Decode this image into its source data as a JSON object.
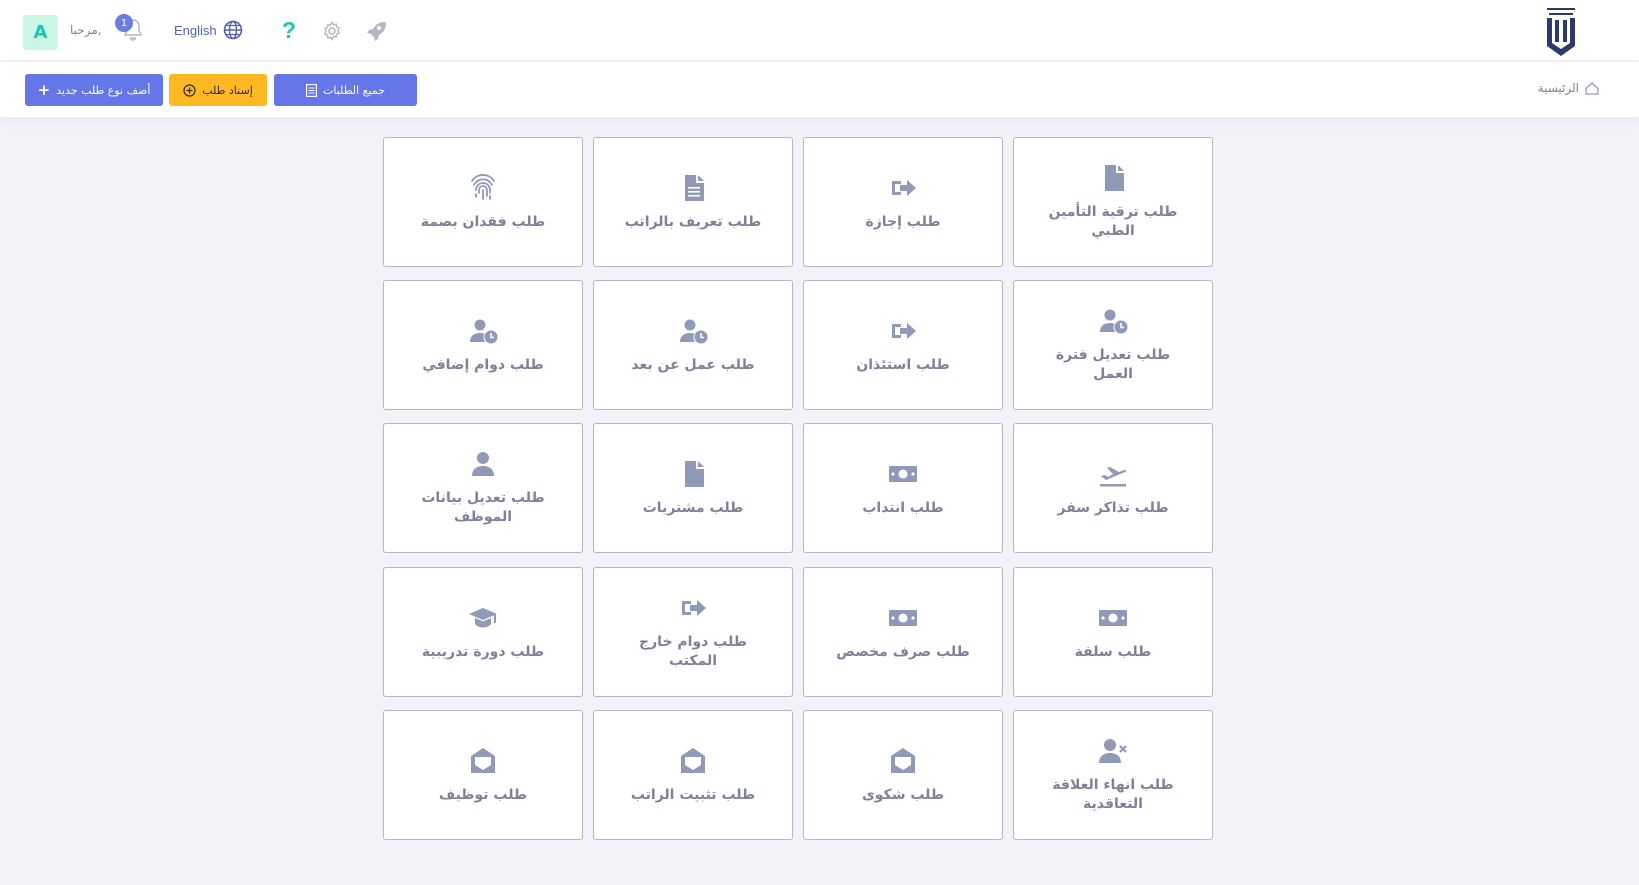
{
  "header": {
    "avatar_letter": "A",
    "greeting": "مرحبا,",
    "notifications_count": "1",
    "language": "English"
  },
  "toolbar": {
    "add_type_label": "أضف نوع طلب جديد",
    "assign_label": "إسناد طلب",
    "all_requests_label": "جميع الطلبات"
  },
  "breadcrumb": {
    "home": "الرئيسية"
  },
  "cards": [
    {
      "label": "طلب ترقية التأمين الطبي",
      "icon": "file-icon"
    },
    {
      "label": "طلب إجازة",
      "icon": "sign-out-icon"
    },
    {
      "label": "طلب تعريف بالراتب",
      "icon": "document-icon"
    },
    {
      "label": "طلب فقدان بصمة",
      "icon": "fingerprint-icon"
    },
    {
      "label": "طلب تعديل فترة العمل",
      "icon": "user-clock-icon"
    },
    {
      "label": "طلب استئذان",
      "icon": "sign-out-icon"
    },
    {
      "label": "طلب عمل عن بعد",
      "icon": "user-clock-icon"
    },
    {
      "label": "طلب دوام إضافي",
      "icon": "user-clock-icon"
    },
    {
      "label": "طلب تذاكر سفر",
      "icon": "plane-departure-icon"
    },
    {
      "label": "طلب انتداب",
      "icon": "money-bill-icon"
    },
    {
      "label": "طلب مشتريات",
      "icon": "file-icon"
    },
    {
      "label": "طلب تعديل بيانات الموظف",
      "icon": "user-icon"
    },
    {
      "label": "طلب سلفة",
      "icon": "money-bill-icon"
    },
    {
      "label": "طلب صرف مخصص",
      "icon": "money-bill-icon"
    },
    {
      "label": "طلب دوام خارج المكتب",
      "icon": "sign-out-icon"
    },
    {
      "label": "طلب دورة تدريبية",
      "icon": "graduation-cap-icon"
    },
    {
      "label": "طلب انهاء العلاقة التعاقدية",
      "icon": "user-times-icon"
    },
    {
      "label": "طلب شكوى",
      "icon": "envelope-open-icon"
    },
    {
      "label": "طلب تثبيت الراتب",
      "icon": "envelope-open-icon"
    },
    {
      "label": "طلب توظيف",
      "icon": "envelope-open-icon"
    }
  ],
  "colors": {
    "primary": "#6576e8",
    "warning": "#ffb822",
    "success": "#1bc5bd",
    "icon": "#9199b8"
  }
}
